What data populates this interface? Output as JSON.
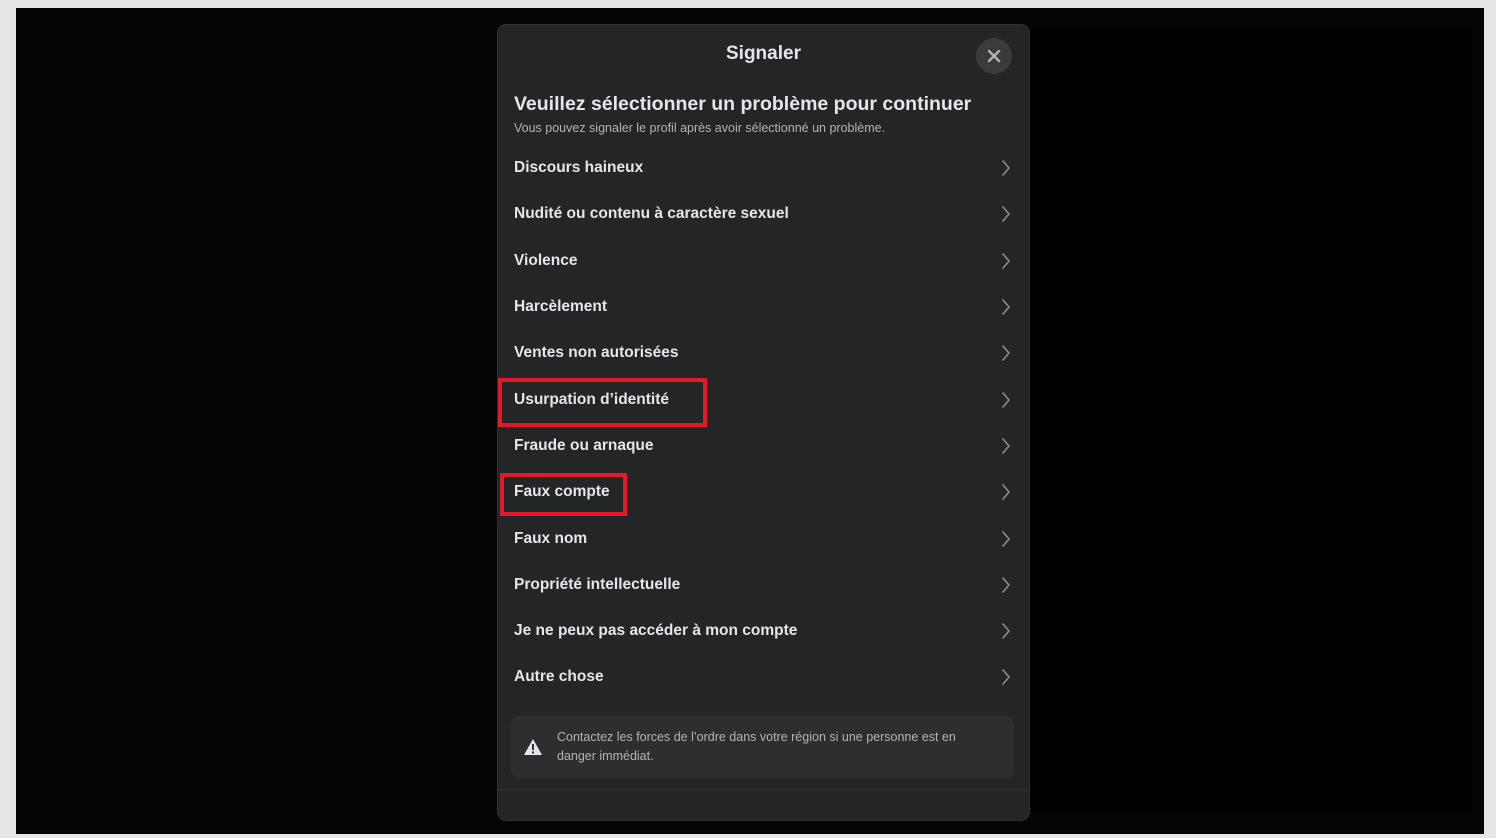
{
  "dialog": {
    "title": "Signaler",
    "close_icon": "close-icon",
    "heading": "Veuillez sélectionner un problème pour continuer",
    "subheading": "Vous pouvez signaler le profil après avoir sélectionné un problème.",
    "options": [
      {
        "label": "Discours haineux"
      },
      {
        "label": "Nudité ou contenu à caractère sexuel"
      },
      {
        "label": "Violence"
      },
      {
        "label": "Harcèlement"
      },
      {
        "label": "Ventes non autorisées"
      },
      {
        "label": "Usurpation d’identité",
        "highlighted": true
      },
      {
        "label": "Fraude ou arnaque"
      },
      {
        "label": "Faux compte",
        "highlighted": true
      },
      {
        "label": "Faux nom"
      },
      {
        "label": "Propriété intellectuelle"
      },
      {
        "label": "Je ne peux pas accéder à mon compte"
      },
      {
        "label": "Autre chose"
      }
    ],
    "notice": "Contactez les forces de l’ordre dans votre région si une personne est en danger immédiat.",
    "notice_icon": "warning-icon"
  },
  "colors": {
    "dialog_bg": "#242526",
    "text_primary": "#e4e6eb",
    "text_secondary": "#b0b3b8",
    "highlight": "#e0192b"
  }
}
